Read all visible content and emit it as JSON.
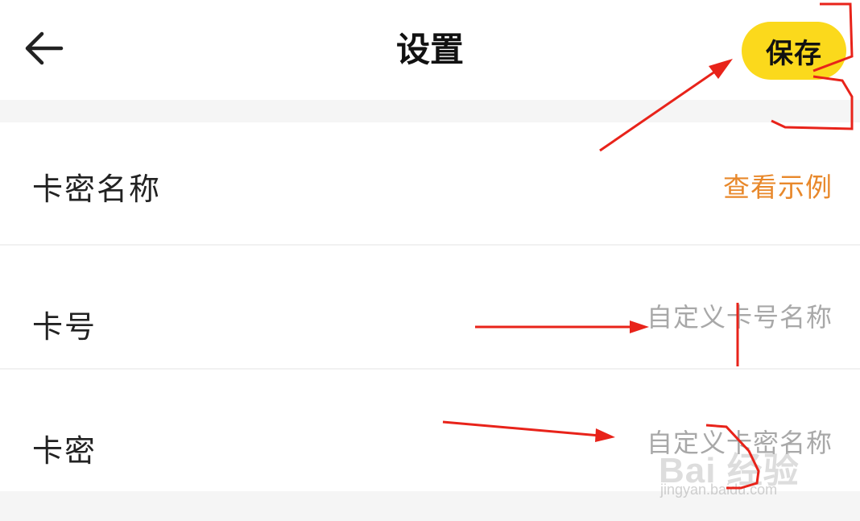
{
  "header": {
    "title": "设置",
    "save_label": "保存",
    "back_icon": "arrow-left-icon"
  },
  "rows": [
    {
      "label": "卡密名称",
      "action": "查看示例"
    },
    {
      "label": "卡号",
      "placeholder": "自定义卡号名称"
    },
    {
      "label": "卡密",
      "placeholder": "自定义卡密名称"
    }
  ],
  "colors": {
    "accent": "#fbd91c",
    "link": "#e8882b",
    "annotation": "#e8231a"
  },
  "watermark": {
    "main": "Bai 经验",
    "sub": "jingyan.baidu.com"
  }
}
